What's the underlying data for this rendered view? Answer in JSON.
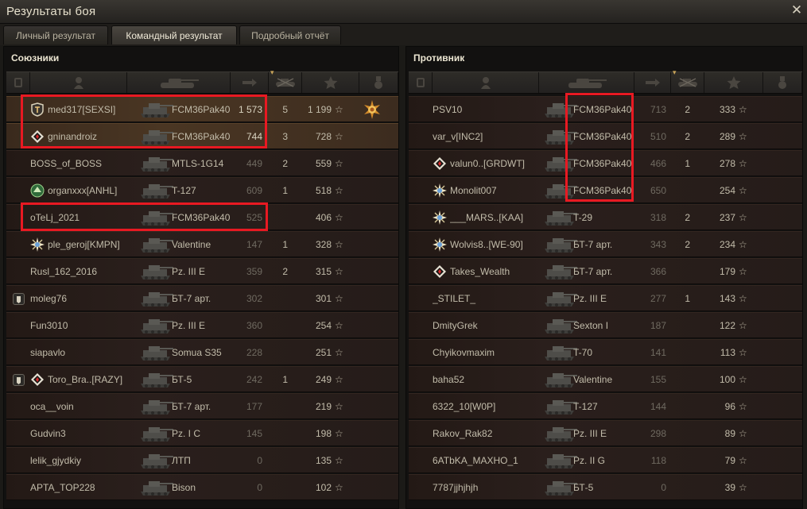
{
  "window": {
    "title": "Результаты боя",
    "close_glyph": "✕"
  },
  "tabs": [
    {
      "label": "Личный результат",
      "active": false
    },
    {
      "label": "Командный результат",
      "active": true
    },
    {
      "label": "Подробный отчёт",
      "active": false
    }
  ],
  "allies": {
    "title": "Союзники",
    "rows": [
      {
        "name": "med317[SEXSI]",
        "badge": "shield-icon",
        "tank": "FCM36Pak40",
        "damage": "1 573",
        "kills": "5",
        "xp": "1 199",
        "medal": true,
        "me": true
      },
      {
        "name": "gninandroiz",
        "badge": "diamond-icon",
        "tank": "FCM36Pak40",
        "damage": "744",
        "kills": "3",
        "xp": "728",
        "medal": false,
        "me": true
      },
      {
        "name": "BOSS_of_BOSS",
        "badge": "",
        "tank": "MTLS-1G14",
        "damage": "449",
        "kills": "2",
        "xp": "559",
        "medal": false,
        "me": false
      },
      {
        "name": "organxxx[ANHL]",
        "badge": "green-emblem-icon",
        "tank": "T-127",
        "damage": "609",
        "kills": "1",
        "xp": "518",
        "medal": false,
        "me": false
      },
      {
        "name": "oTeLj_2021",
        "badge": "",
        "tank": "FCM36Pak40",
        "damage": "525",
        "kills": "",
        "xp": "406",
        "medal": false,
        "me": false
      },
      {
        "name": "ple_geroj[KMPN]",
        "badge": "star-burst-icon",
        "tank": "Valentine",
        "damage": "147",
        "kills": "1",
        "xp": "328",
        "medal": false,
        "me": false
      },
      {
        "name": "Rusl_162_2016",
        "badge": "",
        "tank": "Pz. III E",
        "damage": "359",
        "kills": "2",
        "xp": "315",
        "medal": false,
        "me": false
      },
      {
        "name": "moleg76",
        "badge": "",
        "square": true,
        "tank": "БТ-7 арт.",
        "damage": "302",
        "kills": "",
        "xp": "301",
        "medal": false,
        "me": false
      },
      {
        "name": "Fun3010",
        "badge": "",
        "tank": "Pz. III E",
        "damage": "360",
        "kills": "",
        "xp": "254",
        "medal": false,
        "me": false
      },
      {
        "name": "siapavlo",
        "badge": "",
        "tank": "Somua S35",
        "damage": "228",
        "kills": "",
        "xp": "251",
        "medal": false,
        "me": false
      },
      {
        "name": "Toro_Bra..[RAZY]",
        "badge": "diamond-icon",
        "square": true,
        "tank": "БТ-5",
        "damage": "242",
        "kills": "1",
        "xp": "249",
        "medal": false,
        "me": false
      },
      {
        "name": "oca__voin",
        "badge": "",
        "tank": "БТ-7 арт.",
        "damage": "177",
        "kills": "",
        "xp": "219",
        "medal": false,
        "me": false
      },
      {
        "name": "Gudvin3",
        "badge": "",
        "tank": "Pz. I C",
        "damage": "145",
        "kills": "",
        "xp": "198",
        "medal": false,
        "me": false
      },
      {
        "name": "lelik_gjydkiy",
        "badge": "",
        "tank": "ЛТП",
        "damage": "0",
        "kills": "",
        "xp": "135",
        "medal": false,
        "me": false
      },
      {
        "name": "APTA_TOP228",
        "badge": "",
        "tank": "Bison",
        "damage": "0",
        "kills": "",
        "xp": "102",
        "medal": false,
        "me": false
      }
    ]
  },
  "enemies": {
    "title": "Противник",
    "rows": [
      {
        "name": "PSV10",
        "badge": "",
        "tank": "FCM36Pak40",
        "damage": "713",
        "kills": "2",
        "xp": "333"
      },
      {
        "name": "var_v[INC2]",
        "badge": "",
        "tank": "FCM36Pak40",
        "damage": "510",
        "kills": "2",
        "xp": "289"
      },
      {
        "name": "valun0..[GRDWT]",
        "badge": "diamond-icon",
        "tank": "FCM36Pak40",
        "damage": "466",
        "kills": "1",
        "xp": "278"
      },
      {
        "name": "Monolit007",
        "badge": "star-burst-icon",
        "tank": "FCM36Pak40",
        "damage": "650",
        "kills": "",
        "xp": "254"
      },
      {
        "name": "___MARS..[KAA]",
        "badge": "star-burst-icon",
        "tank": "T-29",
        "damage": "318",
        "kills": "2",
        "xp": "237"
      },
      {
        "name": "Wolvis8..[WE-90]",
        "badge": "star-burst-icon",
        "tank": "БТ-7 арт.",
        "damage": "343",
        "kills": "2",
        "xp": "234"
      },
      {
        "name": "Takes_Wealth",
        "badge": "diamond-icon",
        "tank": "БТ-7 арт.",
        "damage": "366",
        "kills": "",
        "xp": "179"
      },
      {
        "name": "_STILET_",
        "badge": "",
        "tank": "Pz. III E",
        "damage": "277",
        "kills": "1",
        "xp": "143"
      },
      {
        "name": "DmityGrek",
        "badge": "",
        "tank": "Sexton I",
        "damage": "187",
        "kills": "",
        "xp": "122"
      },
      {
        "name": "Chyikovmaxim",
        "badge": "",
        "tank": "T-70",
        "damage": "141",
        "kills": "",
        "xp": "113"
      },
      {
        "name": "baha52",
        "badge": "",
        "tank": "Valentine",
        "damage": "155",
        "kills": "",
        "xp": "100"
      },
      {
        "name": "6322_10[W0P]",
        "badge": "",
        "tank": "T-127",
        "damage": "144",
        "kills": "",
        "xp": "96"
      },
      {
        "name": "Rakov_Rak82",
        "badge": "",
        "tank": "Pz. III E",
        "damage": "298",
        "kills": "",
        "xp": "89"
      },
      {
        "name": "6ATbKA_MAXHO_1",
        "badge": "",
        "tank": "Pz. II G",
        "damage": "118",
        "kills": "",
        "xp": "79"
      },
      {
        "name": "7787jjhjhjh",
        "badge": "",
        "tank": "БТ-5",
        "damage": "0",
        "kills": "",
        "xp": "39"
      }
    ]
  },
  "colors": {
    "highlight": "#e81922",
    "accent": "#f0ead8"
  }
}
